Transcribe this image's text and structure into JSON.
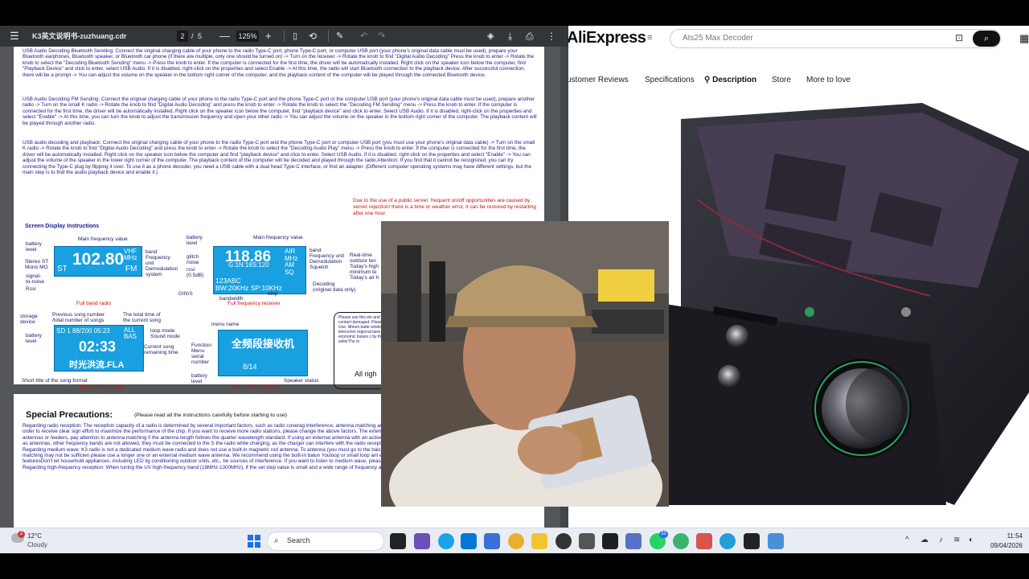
{
  "pdf_viewer": {
    "menu_icon": "hamburger-menu-icon",
    "filename": "K3英文说明书-zuzhuang.cdr",
    "current_page": "2",
    "page_separator": "/",
    "total_pages": "5",
    "zoom": "125%",
    "toolbar_icons": [
      "minus-icon",
      "plus-icon",
      "fit-page-icon",
      "rotate-icon",
      "annotate-icon",
      "undo-icon",
      "redo-icon",
      "ai-assist-icon",
      "download-icon",
      "print-icon",
      "more-icon"
    ],
    "page1": {
      "para1": "USB Audio Decoding Bluetooth Sending: Connect the original charging cable of your phone to the radio Type-C port, phone Type-C port, or computer USB port (your phone's original data cable must be used), prepare your Bluetooth earphones, Bluetooth speaker, or Bluetooth car phone (if there are multiple, only one should be turned on) -> Turn on the receiver -> Rotate the knob to find \"Digital Audio Decoding\" Press the knob to enter -> Rotate the knob to select the \"Decoding Bluetooth Sending\" menu -> Press the knob to enter. If the computer is connected for the first time, the driver will be automatically installed. Right click on the speaker icon below the computer, find \"Playback Device\" and click to enter, select USB Audio. If it is disabled, right-click on the properties and select Enable -> At this time, the radio will start Bluetooth connection to the playback device. After successful connection, there will be a prompt -> You can adjust the volume on the speaker in the bottom right corner of the computer, and the playback content of the computer will be played through the connected Bluetooth device.",
      "para2": "USB Audio Decoding FM Sending: Connect the original charging cable of your phone to the radio Type-C port and the phone Type-C port or the computer USB port (your phone's original data cable must be used), prepare another radio -> Turn on the small K radio -> Rotate the knob to find \"Digital Audio Decoding\" and press the knob to enter -> Rotate the knob to select the \"Decoding FM Sending\" menu -> Press the knob to enter. If the computer is connected for the first time, the driver will be automatically installed. Right click on the speaker icon below the computer, find \"playback device\" and click to enter. Select USB Audio. If it is disabled, right-click on the properties and select \"Enable\" -> At this time, you can turn the knob to adjust the transmission frequency and open your other radio -> You can adjust the volume on the speaker in the bottom right corner of the computer. The playback content will be played through another radio.",
      "para3": "USB audio decoding and playback: Connect the original charging cable of your phone to the radio Type-C port and the phone Type-C port or computer USB port (you must use your phone's original data cable) -> Turn on the small K radio -> Rotate the knob to find \"Digital Audio Decoding\" and press the knob to enter -> Rotate the knob to select the \"Decoding Audio Play\" menu -> Press the knob to enter. If the computer is connected for the first time, the driver will be automatically installed. Right click on the speaker icon below the computer and find \"playback device\" and click to enter. Select USB Audio. If it is disabled, right-click on the properties and select \"Enable\" -> You can adjust the volume of the speaker in the lower right corner of the computer. The playback content of the computer will be decoded and played through the radio.Attention: If you find that it cannot be recognized, you can try connecting the Type-C plug by flipping it over. To use it as a phone decoder, you need a USB cable with a dual head Type-C interface, or find an adapter. (Different computer operating systems may have different settings, but the main step is to find the audio playback device and enable it.)",
      "screen_title": "Screen Display Instructions",
      "notice": "Due to the use of a public server, frequent on/off opportunities are caused by server rejection! there is a time or weather error, it can be restored by restarting after one hour",
      "lcd1": {
        "freq": "102.80",
        "band": "VHF\nMHz",
        "stereo": "ST",
        "mode": "FM"
      },
      "lcd2": {
        "freq": "118.86",
        "freq_small": "66",
        "sub": "G:1N:16S:120",
        "air": "AIR\nMHz\nAM\nSQ",
        "rds": "123ABC\nBW:20KHz SP:10KHz"
      },
      "lcd3": {
        "top": "SD 1 88/200 05:23",
        "all": "ALL\nBAS",
        "time": "02:33",
        "song": "时光洪流.FLA"
      },
      "lcd4": {
        "title": "全频段接收机",
        "count": "8/14"
      },
      "labels": {
        "main_freq_1": "Main frequency value",
        "battery_1": "battery\nlevel",
        "stereo": "Stereo ST\nMono MO",
        "signal_noise": "signal-\nto-noise",
        "rssi": "Rssi",
        "band_1": "band\nFrequency\nunit\nDemodulation\nsystem",
        "cap_full_band": "Full band radio",
        "battery_2": "battery\nlevel",
        "glitch": "glitch\nnoise",
        "rssi2": "rssi\n(0.5dB)",
        "gns": "G\\N\\S",
        "main_freq_2": "Main frequency value",
        "band_2": "band\nFrequency unit\nDemodulation\nSquelch",
        "decoding": "Decoding\n(original data only)",
        "bandwidth": "bandwidth",
        "step": "step",
        "cap_full_freq": "Full frequency receiver",
        "realtime": "Real-time\noutdoor ten\nToday's high\nminimum te\nToday's air h",
        "storage": "storage\ndevice",
        "prev_song": "Previous song number\n/total number of songs",
        "total_time": "The total time of\nthe current song",
        "battery_3": "battery\nlevel",
        "loop": "loop mode\nSound mode",
        "current_song": "Current song\nremaining time",
        "short_title": "Short title of the song format",
        "cap_music": "Digital music player",
        "menu_name": "menu name",
        "function": "Function\nMenu\nserial\nnumber",
        "battery_4": "battery\nlevel",
        "speaker_status": "Speaker status",
        "cap_menu": "Main menu interface"
      },
      "tip_text": "Please use this ele and avoid contact damaged. Please u Use, lithium batte wireless telecomm regional laws and economic losses c by the sellerThe m",
      "tip_rights": "All righ"
    },
    "page2": {
      "title": "Special Precautions:",
      "subtitle": "(Please read all the instructions carefully before starting to use)",
      "para1": "Regarding radio reception: The reception capacity of a radio is determined by several important factors, such as radio coverag interference, antenna matching and performance, and whether the operator is operating correctly in order to receive clear sign effort to maximize the performance of the chip. If you want to receive more radio stations, please change the above factors. The external antenna, please purchase an SMA interface inner pin For special antennas or feeders, pay attention to antenna matching if the antenna length follows the quarter wavelength standard. If using an external antenna with an active amplifier, it is necessa usedEarphones or AUX cables can be used as antennas, other frequency bands are not allowed, they must be connected to the S the radio while charging, as the charger can interfere with the radio reception.",
      "para2": "Regarding medium wave: K3 radio is not a dedicated medium wave radio and does not use a built-in magnetic rod antenna. To antenna (you must go to the balcony or outdoors). Medium wave is long, and simple rod antenna matching may not be sufficien please use a longer one or an external medium wave antenna. We recommend using the built-in balun Youloop or small loop ant easily interfered with by buildings, mountains, urban cars, and special featuresDon't let household appliances, including LED lig conditioning outdoor units, etc., be sources of interference. If you want to listen to medium wave, please turn off all surrounding the antenna to receive clearly.",
      "para3": "Regarding high-frequency reception: When tuning the UV high-frequency band (18MHz-1300MHz), if the set step value is small and a wide range of frequency adjustment is"
    }
  },
  "aliexpress": {
    "logo": "AliExpress",
    "category_icon": "menu-lines-icon",
    "search_placeholder": "Ats25 Max Decoder",
    "camera_icon": "image-search-icon",
    "search_icon": "search-icon",
    "grid_icon": "app-grid-icon",
    "tabs": [
      {
        "label": "ustomer Reviews"
      },
      {
        "label": "Specifications"
      },
      {
        "label": "Description",
        "icon": "location-pin-icon"
      },
      {
        "label": "Store"
      },
      {
        "label": "More to love"
      }
    ],
    "product_image": "K3 radio receiver product photo"
  },
  "webcam": {
    "content": "presenter webcam overlay holding a small device"
  },
  "taskbar": {
    "weather_badge": "2",
    "temperature": "12°C",
    "condition": "Cloudy",
    "search_label": "Search",
    "app_badge_1": "32",
    "time": "11:54",
    "date": "09/04/2026",
    "colors": {
      "start": "#1a73e8",
      "taskbar_bg": "#e9edf3"
    }
  }
}
